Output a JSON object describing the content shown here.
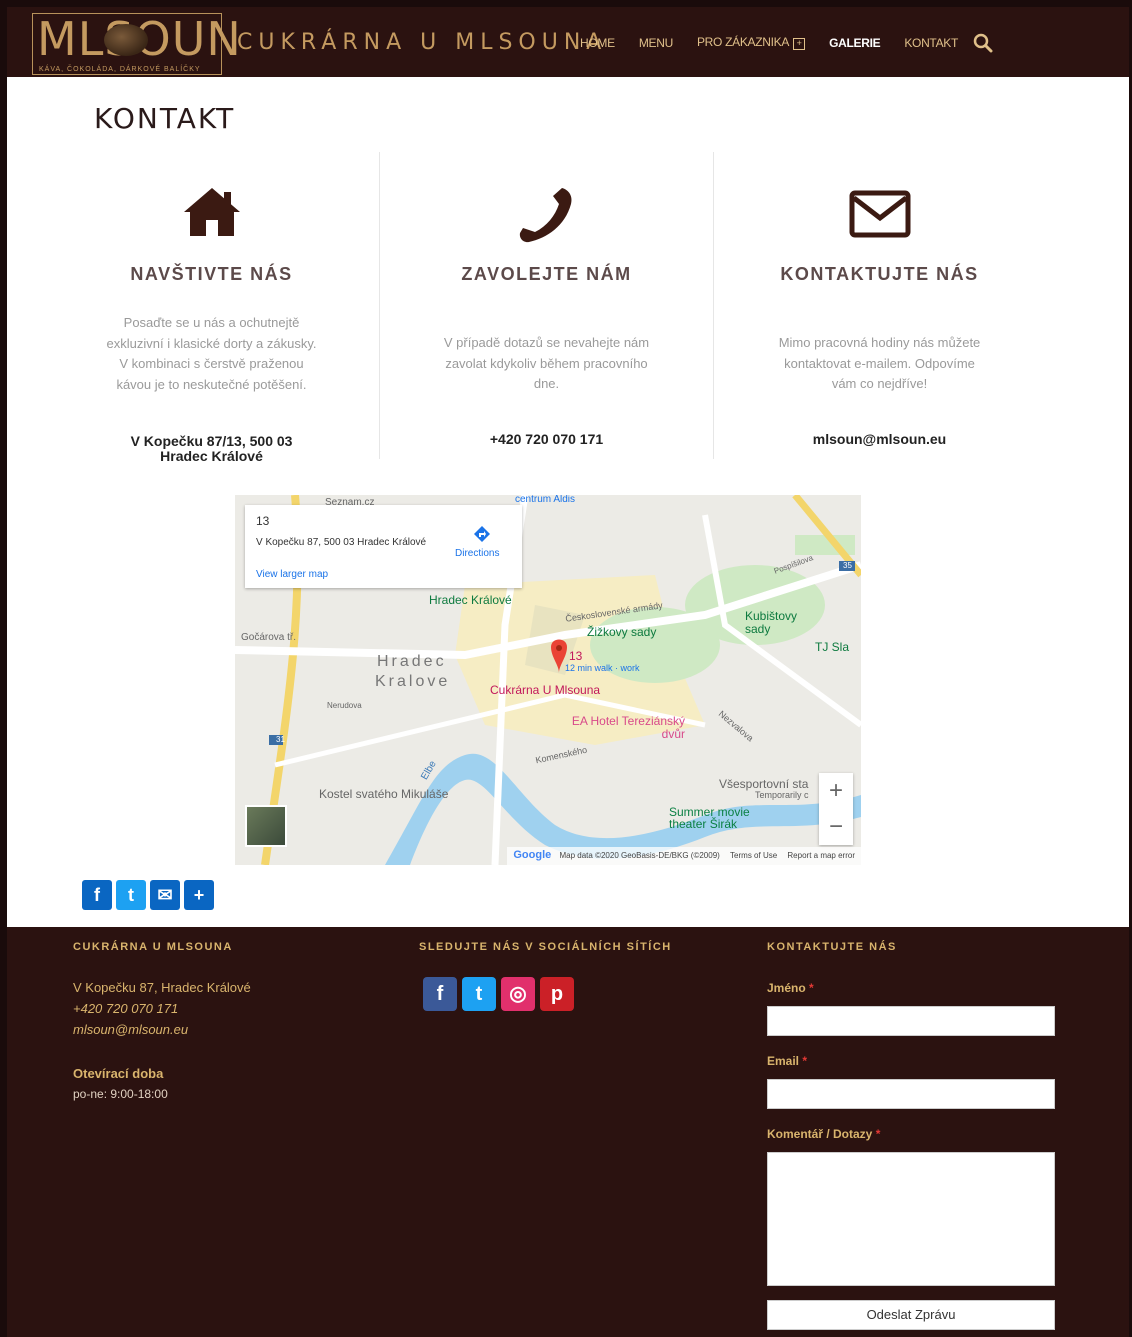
{
  "header": {
    "logo_word": "MLSOUN",
    "logo_sub": "KÁVA, ČOKOLÁDA, DÁRKOVÉ BALÍČKY",
    "brand": "CUKRÁRNA U MLSOUNA",
    "nav": [
      "HOME",
      "MENU",
      "PRO ZÁKAZNIKA",
      "GALERIE",
      "KONTAKT"
    ],
    "plus_glyph": "+",
    "active_nav": "GALERIE"
  },
  "page": {
    "title": "KONTAKT",
    "columns": [
      {
        "icon": "home-icon",
        "heading": "NAVŠTIVTE NÁS",
        "text": "Posaďte se u nás a ochutnejtě exkluzivní i klasické dorty a zákusky. V kombinaci s čerstvě praženou kávou je to neskutečné potěšení.",
        "strong": "V Kopečku 87/13, 500 03 Hradec Králové"
      },
      {
        "icon": "phone-icon",
        "heading": "ZAVOLEJTE NÁM",
        "text": "V případě dotazů se nevahejte nám zavolat kdykoliv během pracovního dne.",
        "strong": "+420 720 070 171"
      },
      {
        "icon": "envelope-icon",
        "heading": "KONTAKTUJTE NÁS",
        "text": "Mimo pracovná hodiny nás můžete kontaktovat e-mailem. Odpovíme vám co nejdříve!",
        "strong": "mlsoun@mlsoun.eu"
      }
    ]
  },
  "map": {
    "card_number": "13",
    "card_address": "V Kopečku 87, 500 03 Hradec Králové",
    "directions": "Directions",
    "view_larger": "View larger map",
    "zoom_in": "+",
    "zoom_out": "−",
    "labels": {
      "city": "Hradec",
      "city2": "Kralove",
      "pin": "Cukrárna U Mlsouna",
      "pin_num": "13",
      "walk": "12 min walk · work",
      "park": "Žižkovy sady",
      "park2": "Československé armády",
      "kubistovy": "Kubištovy sady",
      "tj": "TJ Sla",
      "ea_hotel": "EA Hotel Tereziánský dvůr",
      "church": "Kostel svatého Mikuláše",
      "summer": "Summer movie theater Širák",
      "vsesport": "Všesportovní sta",
      "temporarily": "Temporarily c",
      "gocarova": "Gočárova tř.",
      "nerudova": "Nerudova",
      "komenskeho": "Komenského",
      "nezvalova": "Nezvalova",
      "elbe": "Elbe",
      "seznam": "Seznam.cz",
      "centrum": "centrum Aldis",
      "hradec_kralove_stop": "Hradec Králové",
      "pospisilova": "Pospíšilova",
      "google": "Google",
      "map_data": "Map data ©2020 GeoBasis-DE/BKG (©2009)",
      "terms": "Terms of Use",
      "report": "Report a map error",
      "road_31": "31",
      "road_35": "35"
    }
  },
  "share": [
    "f",
    "t",
    "✉",
    "+"
  ],
  "footer": {
    "col1_head": "CUKRÁRNA U MLSOUNA",
    "address": "V Kopečku 87, Hradec Králové",
    "phone": "+420 720 070 171",
    "email": "mlsoun@mlsoun.eu",
    "hours_head": "Otevírací doba",
    "hours": "po-ne: 9:00-18:00",
    "col2_head": "SLEDUJTE NÁS V SOCIÁLNÍCH SÍTÍCH",
    "col3_head": "KONTAKTUJTE NÁS",
    "name_label": "Jméno",
    "email_label": "Email",
    "comment_label": "Komentář / Dotazy",
    "required_mark": "*",
    "submit": "Odeslat Zprávu",
    "colors": {
      "bg": "#2b1210",
      "accent": "#d9b46d"
    }
  }
}
